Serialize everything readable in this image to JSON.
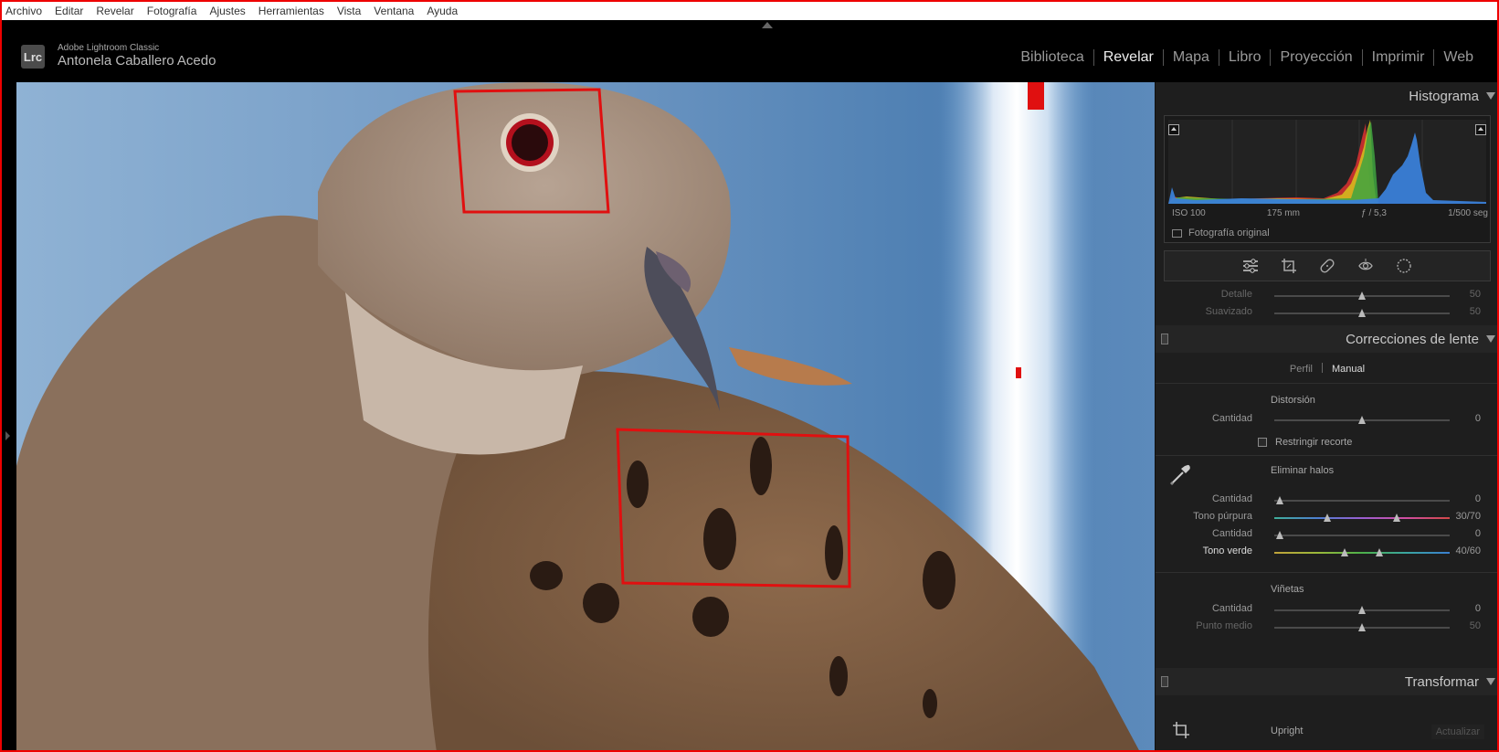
{
  "menu": [
    "Archivo",
    "Editar",
    "Revelar",
    "Fotografía",
    "Ajustes",
    "Herramientas",
    "Vista",
    "Ventana",
    "Ayuda"
  ],
  "identity": {
    "logo": "Lrc",
    "app_name": "Adobe Lightroom Classic",
    "user_name": "Antonela Caballero Acedo"
  },
  "modules": {
    "items": [
      "Biblioteca",
      "Revelar",
      "Mapa",
      "Libro",
      "Proyección",
      "Imprimir",
      "Web"
    ],
    "active": "Revelar"
  },
  "histogram": {
    "title": "Histograma",
    "exif": {
      "iso": "ISO 100",
      "focal": "175 mm",
      "aperture": "ƒ / 5,3",
      "shutter": "1/500 seg"
    },
    "original_photo": "Fotografía original"
  },
  "tools": [
    "sliders-icon",
    "crop-icon",
    "healing-icon",
    "red-eye-icon",
    "mask-icon"
  ],
  "detail_partial": {
    "rows": [
      {
        "label": "Detalle",
        "value": "50",
        "position": 0.5
      },
      {
        "label": "Suavizado",
        "value": "50",
        "position": 0.5
      }
    ]
  },
  "lens": {
    "title": "Correcciones de lente",
    "tabs": {
      "profile": "Perfil",
      "manual": "Manual",
      "active": "Manual"
    },
    "distortion": {
      "title": "Distorsión",
      "amount": {
        "label": "Cantidad",
        "value": "0",
        "position": 0.5
      },
      "constrain_crop": "Restringir recorte"
    },
    "defringe": {
      "title": "Eliminar halos",
      "purple_amount": {
        "label": "Cantidad",
        "value": "0",
        "position": 0.0
      },
      "purple_hue": {
        "label": "Tono púrpura",
        "value": "30/70",
        "low": 0.3,
        "high": 0.7
      },
      "green_amount": {
        "label": "Cantidad",
        "value": "0",
        "position": 0.0
      },
      "green_hue": {
        "label": "Tono verde",
        "value": "40/60",
        "low": 0.4,
        "high": 0.6
      }
    },
    "vignette": {
      "title": "Viñetas",
      "amount": {
        "label": "Cantidad",
        "value": "0",
        "position": 0.5
      },
      "midpoint": {
        "label": "Punto medio",
        "value": "50",
        "position": 0.5
      }
    }
  },
  "transform": {
    "title": "Transformar",
    "upright": "Upright",
    "update": "Actualizar"
  },
  "colors": {
    "annotation_red": "#e01010",
    "active_text": "#eeeeee",
    "panel_bg": "#1e1e1e"
  }
}
